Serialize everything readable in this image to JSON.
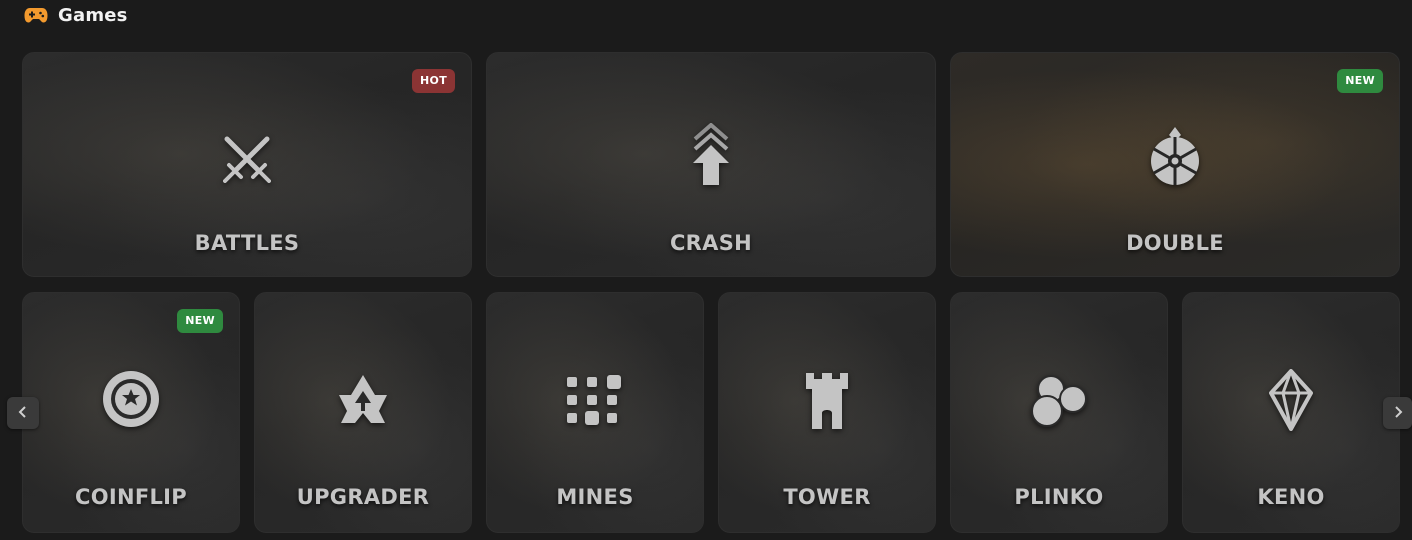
{
  "header": {
    "title": "Games",
    "icon": "gamepad-icon"
  },
  "colors": {
    "background": "#1b1b1b",
    "hot_badge": "#8b3434",
    "new_badge": "#2f8a3f",
    "gamepad": "#f39a2e"
  },
  "games_row1": [
    {
      "label": "BATTLES",
      "icon": "crossed-swords-icon",
      "badge": "HOT"
    },
    {
      "label": "CRASH",
      "icon": "rising-arrow-icon",
      "badge": ""
    },
    {
      "label": "DOUBLE",
      "icon": "roulette-wheel-icon",
      "badge": "NEW"
    }
  ],
  "games_row2": [
    {
      "label": "COINFLIP",
      "icon": "coin-icon",
      "badge": "NEW"
    },
    {
      "label": "UPGRADER",
      "icon": "upgrade-icon",
      "badge": ""
    },
    {
      "label": "MINES",
      "icon": "grid-icon",
      "badge": ""
    },
    {
      "label": "TOWER",
      "icon": "tower-icon",
      "badge": ""
    },
    {
      "label": "PLINKO",
      "icon": "balls-icon",
      "badge": ""
    },
    {
      "label": "KENO",
      "icon": "diamond-icon",
      "badge": ""
    }
  ],
  "carousel": {
    "prev_icon": "chevron-left-icon",
    "next_icon": "chevron-right-icon"
  }
}
